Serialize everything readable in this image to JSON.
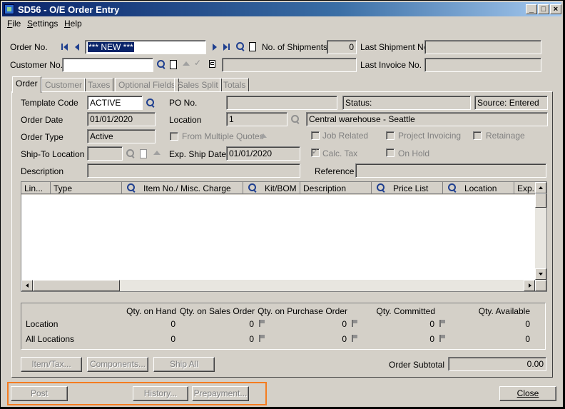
{
  "window": {
    "title": "SD56 - O/E Order Entry"
  },
  "menu": [
    "File",
    "Settings",
    "Help"
  ],
  "header": {
    "order_no_label": "Order No.",
    "order_no_value": "*** NEW ***",
    "shipments_label": "No. of Shipments",
    "shipments_value": "0",
    "last_shipment_label": "Last Shipment No.",
    "customer_label": "Customer No.",
    "last_invoice_label": "Last Invoice No."
  },
  "tabs": [
    "Order",
    "Customer",
    "Taxes",
    "Optional Fields",
    "Sales Split",
    "Totals"
  ],
  "order": {
    "template_label": "Template Code",
    "template_value": "ACTIVE",
    "po_label": "PO No.",
    "status_text": "Status:",
    "source_text": "Source: Entered",
    "order_date_label": "Order Date",
    "order_date_value": "01/01/2020",
    "location_label": "Location",
    "location_value": "1",
    "location_desc": "Central warehouse - Seattle",
    "order_type_label": "Order Type",
    "order_type_value": "Active",
    "from_quotes_label": "From Multiple Quotes",
    "job_related_label": "Job Related",
    "project_invoicing_label": "Project Invoicing",
    "retainage_label": "Retainage",
    "ship_to_label": "Ship-To Location",
    "exp_ship_label": "Exp. Ship Date",
    "exp_ship_value": "01/01/2020",
    "calc_tax_label": "Calc. Tax",
    "on_hold_label": "On Hold",
    "description_label": "Description",
    "reference_label": "Reference"
  },
  "grid": {
    "columns": [
      "Lin...",
      "Type",
      "Item No./ Misc. Charge",
      "Kit/BOM",
      "Description",
      "Price List",
      "Location",
      "Exp."
    ]
  },
  "qty": {
    "headers": [
      "Qty. on Hand",
      "Qty. on Sales Order",
      "Qty. on Purchase Order",
      "Qty. Committed",
      "Qty. Available"
    ],
    "rows": [
      {
        "label": "Location",
        "values": [
          "0",
          "0",
          "0",
          "0",
          "0"
        ]
      },
      {
        "label": "All Locations",
        "values": [
          "0",
          "0",
          "0",
          "0",
          "0"
        ]
      }
    ]
  },
  "buttons": {
    "item_tax": "Item/Tax...",
    "components": "Components...",
    "ship_all": "Ship All",
    "post": "Post",
    "history": "History...",
    "prepayment": "Prepayment...",
    "close": "Close"
  },
  "subtotal": {
    "label": "Order Subtotal",
    "value": "0.00"
  },
  "colors": {
    "highlight": "#f47c20",
    "title_bar": "#0a246a"
  }
}
